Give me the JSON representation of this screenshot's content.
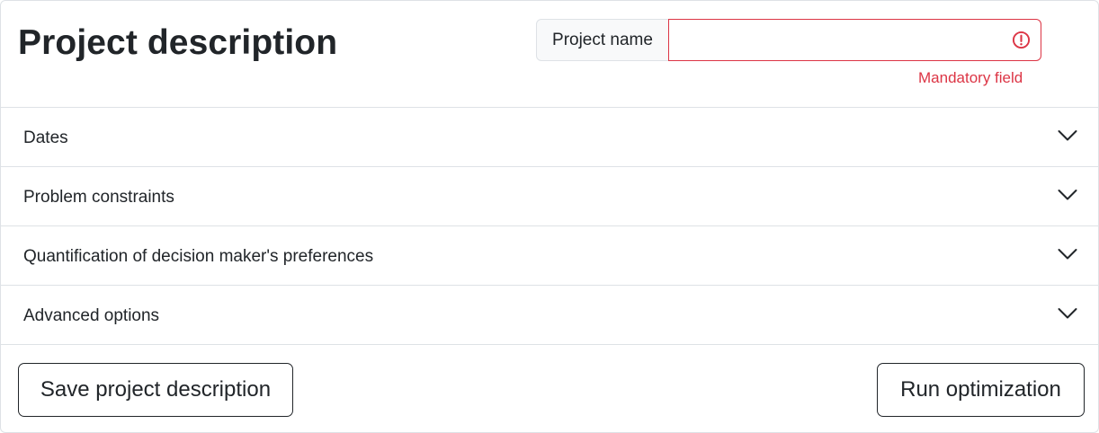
{
  "header": {
    "title": "Project description"
  },
  "project_name": {
    "label": "Project name",
    "value": "",
    "placeholder": "",
    "error": "Mandatory field",
    "error_color": "#dc3545"
  },
  "accordion": {
    "items": [
      {
        "label": "Dates",
        "expanded": false
      },
      {
        "label": "Problem constraints",
        "expanded": false
      },
      {
        "label": "Quantification of decision maker's preferences",
        "expanded": false
      },
      {
        "label": "Advanced options",
        "expanded": false
      }
    ]
  },
  "actions": {
    "save_label": "Save project description",
    "run_label": "Run optimization"
  },
  "icons": {
    "error": "exclamation-circle-icon",
    "expand": "chevron-down-icon"
  }
}
